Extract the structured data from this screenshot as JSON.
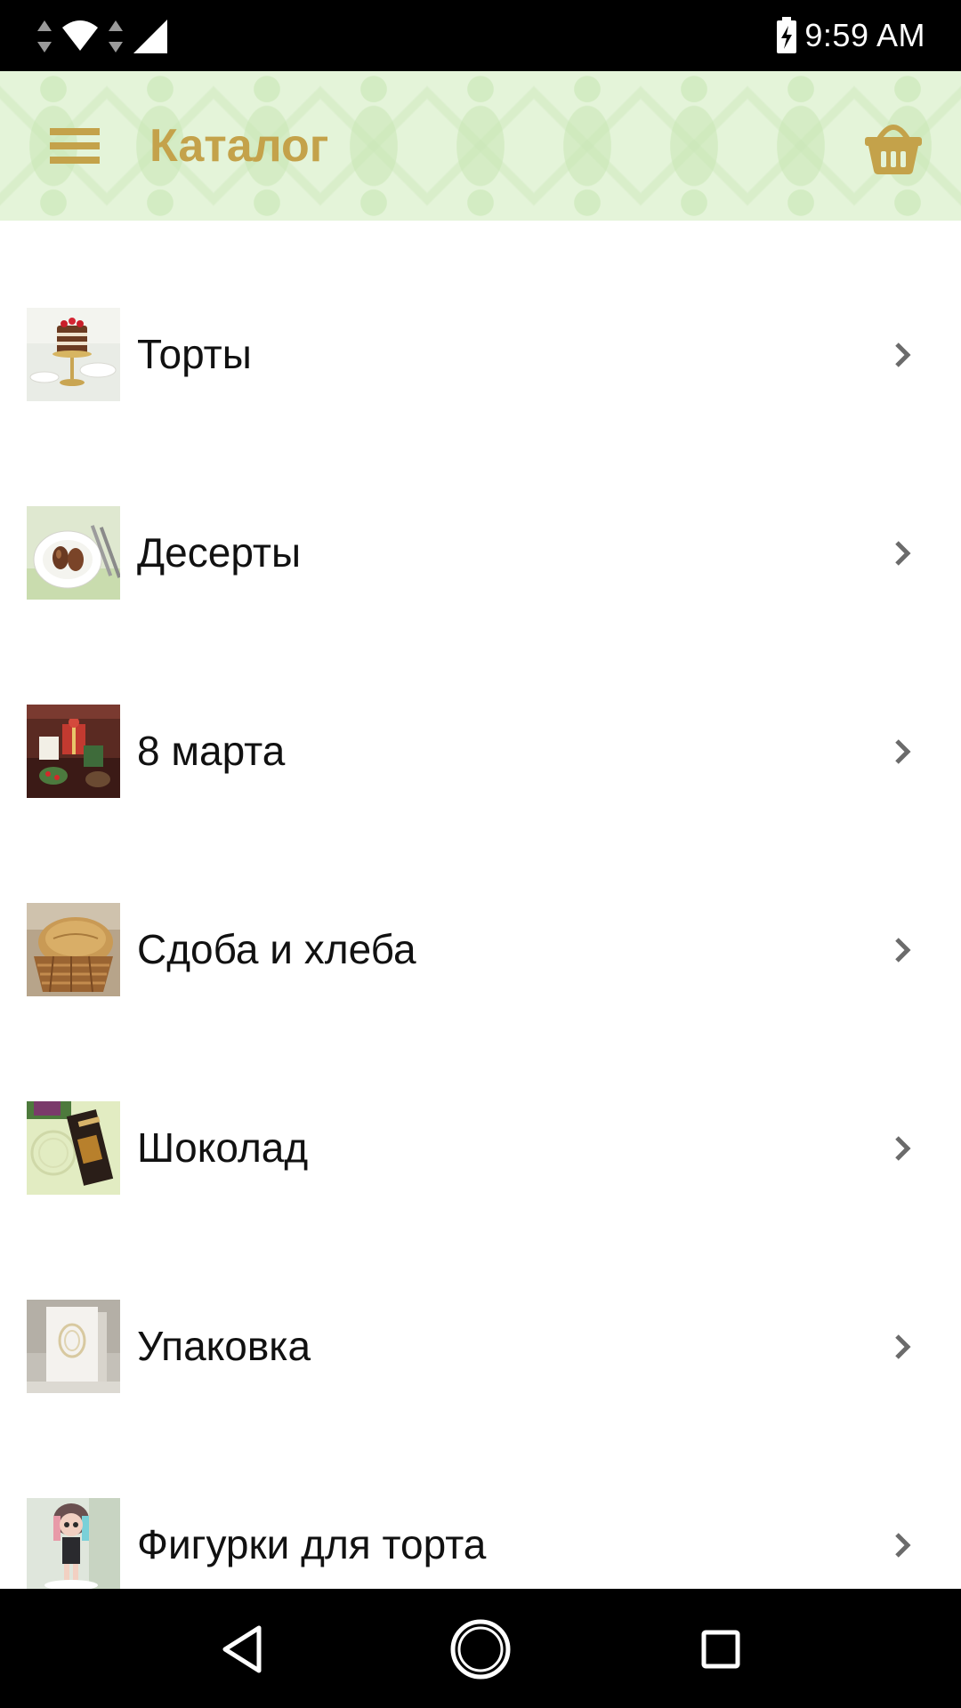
{
  "status_bar": {
    "time": "9:59 AM",
    "icons": [
      "data-arrows-icon",
      "wifi-icon",
      "signal-icon",
      "battery-charging-icon"
    ]
  },
  "app_bar": {
    "title": "Каталог",
    "menu_icon": "hamburger-menu-icon",
    "cart_icon": "basket-icon",
    "accent_color": "#c4a24a",
    "background_color": "#e4f4d9"
  },
  "catalog": {
    "items": [
      {
        "label": "Торты",
        "thumb": "cake-thumbnail"
      },
      {
        "label": "Десерты",
        "thumb": "dessert-thumbnail"
      },
      {
        "label": "8 марта",
        "thumb": "march8-thumbnail"
      },
      {
        "label": "Сдоба и хлеба",
        "thumb": "bread-thumbnail"
      },
      {
        "label": "Шоколад",
        "thumb": "chocolate-thumbnail"
      },
      {
        "label": "Упаковка",
        "thumb": "packaging-thumbnail"
      },
      {
        "label": "Фигурки для торта",
        "thumb": "figurine-thumbnail"
      }
    ],
    "chevron_icon": "chevron-right-icon"
  },
  "nav_bar": {
    "back_icon": "back-triangle-icon",
    "home_icon": "home-circle-icon",
    "recents_icon": "recents-square-icon"
  }
}
